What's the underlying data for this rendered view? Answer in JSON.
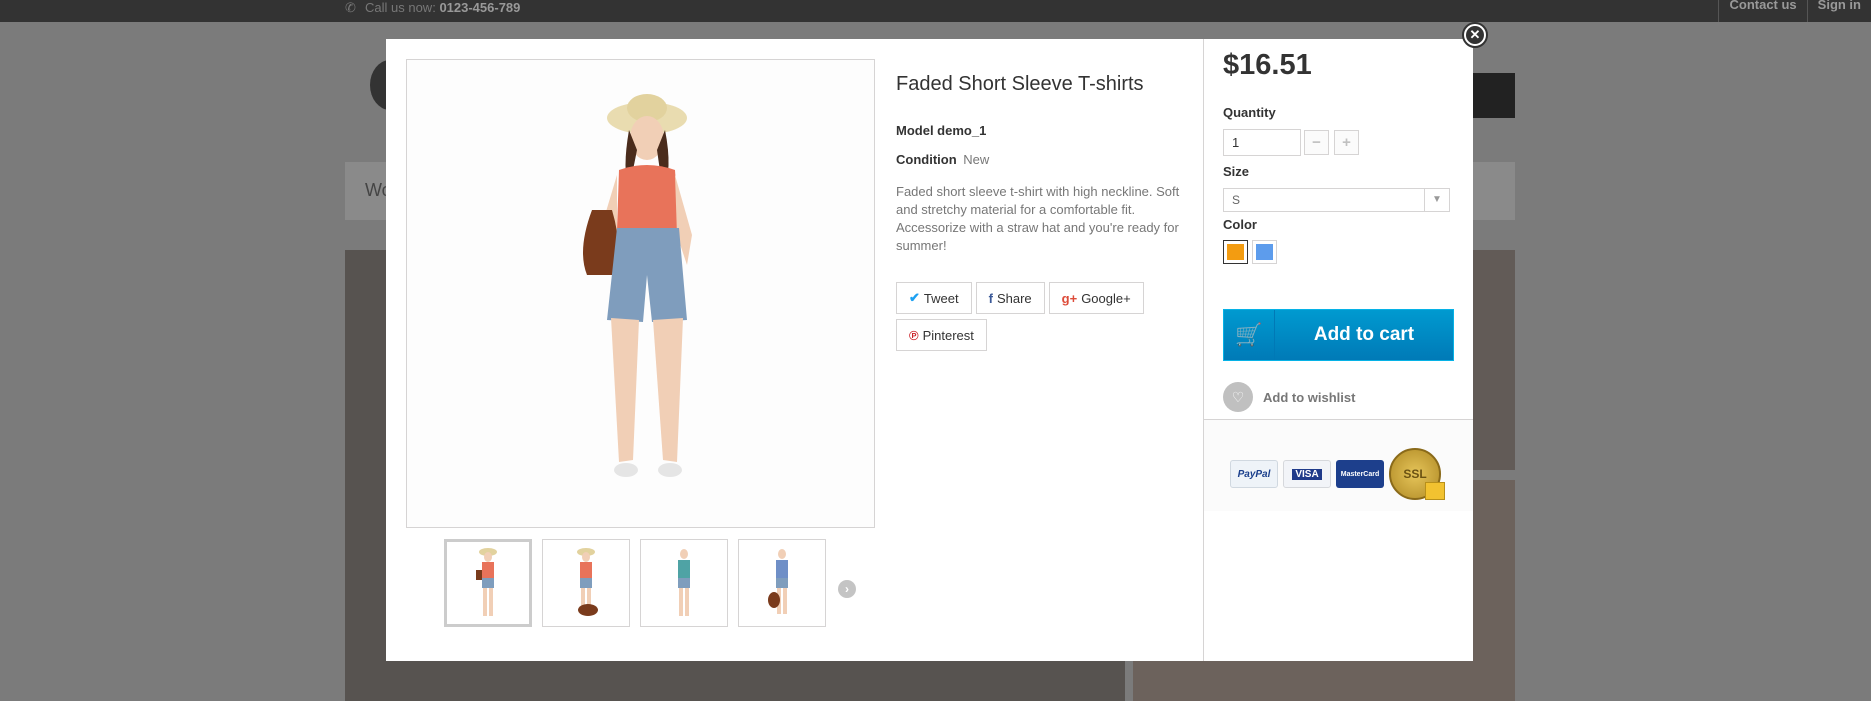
{
  "topbar": {
    "call_prefix": "Call us now:",
    "phone": "0123-456-789",
    "contact": "Contact us",
    "signin": "Sign in"
  },
  "background": {
    "menu_text": "Wo"
  },
  "modal": {
    "close_icon": "close-icon",
    "product": {
      "title": "Faded Short Sleeve T-shirts",
      "model": "Model demo_1",
      "condition_label": "Condition",
      "condition_value": "New",
      "description": "Faded short sleeve t-shirt with high neckline. Soft and stretchy material for a comfortable fit. Accessorize with a straw hat and you're ready for summer!"
    },
    "share": [
      {
        "label": "Tweet",
        "icon": "twitter-icon"
      },
      {
        "label": "Share",
        "icon": "facebook-icon"
      },
      {
        "label": "Google+",
        "icon": "google-plus-icon"
      },
      {
        "label": "Pinterest",
        "icon": "pinterest-icon"
      }
    ],
    "buy": {
      "price": "$16.51",
      "quantity_label": "Quantity",
      "quantity_value": "1",
      "size_label": "Size",
      "size_value": "S",
      "color_label": "Color",
      "colors": [
        "#F39C11",
        "#5D9CEC"
      ],
      "add_to_cart": "Add to cart",
      "wishlist": "Add to wishlist"
    },
    "payments": {
      "paypal": "PayPal",
      "visa": "VISA",
      "mastercard": "MasterCard",
      "ssl": "SSL"
    }
  }
}
